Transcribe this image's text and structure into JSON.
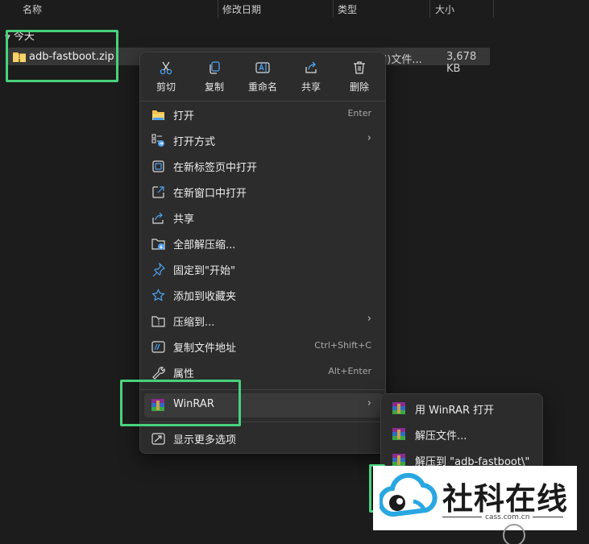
{
  "columns": {
    "name": "名称",
    "date": "修改日期",
    "type": "类型",
    "size": "大小"
  },
  "group": {
    "label": "今天"
  },
  "file": {
    "name": "adb-fastboot.zip",
    "type": "d)文件...",
    "size": "3,678 KB",
    "icon": "zip-folder-icon"
  },
  "quick_actions": [
    {
      "label": "剪切",
      "icon": "cut-icon"
    },
    {
      "label": "复制",
      "icon": "copy-icon"
    },
    {
      "label": "重命名",
      "icon": "rename-icon"
    },
    {
      "label": "共享",
      "icon": "share-icon"
    },
    {
      "label": "删除",
      "icon": "delete-icon"
    }
  ],
  "menu": [
    {
      "label": "打开",
      "shortcut": "Enter",
      "icon": "folder-open-icon"
    },
    {
      "label": "打开方式",
      "submenu": true,
      "icon": "open-with-icon"
    },
    {
      "label": "在新标签页中打开",
      "icon": "new-tab-icon"
    },
    {
      "label": "在新窗口中打开",
      "icon": "new-window-icon"
    },
    {
      "label": "共享",
      "icon": "share-icon"
    },
    {
      "label": "全部解压缩...",
      "icon": "extract-all-icon"
    },
    {
      "label": "固定到\"开始\"",
      "icon": "pin-icon"
    },
    {
      "label": "添加到收藏夹",
      "icon": "star-icon"
    },
    {
      "label": "压缩到...",
      "submenu": true,
      "icon": "compress-folder-icon"
    },
    {
      "label": "复制文件地址",
      "shortcut": "Ctrl+Shift+C",
      "icon": "copy-path-icon"
    },
    {
      "label": "属性",
      "shortcut": "Alt+Enter",
      "icon": "wrench-icon"
    },
    {
      "label": "WinRAR",
      "submenu": true,
      "icon": "winrar-icon"
    },
    {
      "label": "显示更多选项",
      "icon": "show-more-icon"
    }
  ],
  "winrar_submenu": [
    {
      "label": "用 WinRAR 打开",
      "icon": "winrar-icon"
    },
    {
      "label": "解压文件...",
      "icon": "winrar-icon"
    },
    {
      "label": "解压到 \"adb-fastboot\\\"",
      "icon": "winrar-icon"
    }
  ],
  "watermark": {
    "brand": "社科在线",
    "url": "cass.com.cn"
  },
  "colors": {
    "background": "#1c1c1c",
    "menu_bg": "#2c2c2c",
    "highlight": "#48d27d",
    "accent_blue": "#4ea2f0",
    "folder_yellow": "#f2c24c",
    "watermark_blue": "#29a7e1"
  }
}
